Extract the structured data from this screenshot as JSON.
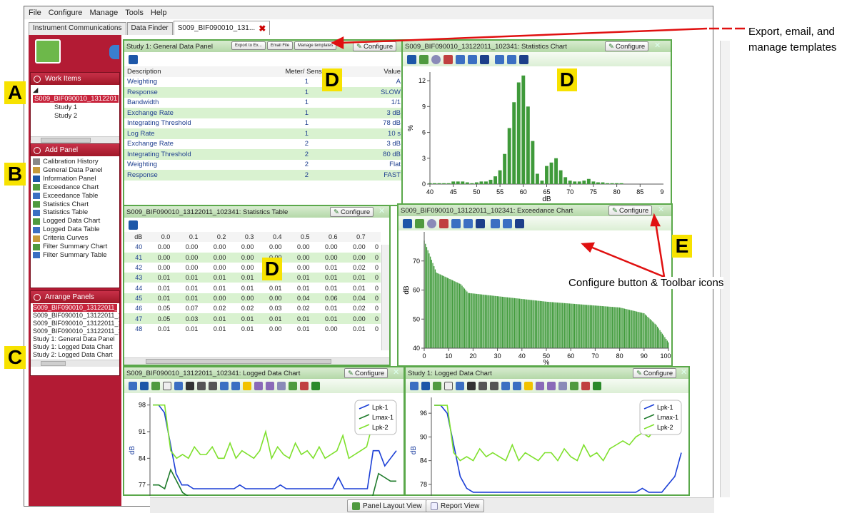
{
  "menu": [
    "File",
    "Configure",
    "Manage",
    "Tools",
    "Help"
  ],
  "tabs": {
    "t1": "Instrument Communications",
    "t2": "Data Finder",
    "t3": "S009_BIF090010_131..."
  },
  "work_items": {
    "title": "Work Items",
    "root": "S009_BIF090010_1312201",
    "children": [
      "Study 1",
      "Study 2"
    ]
  },
  "add_panel": {
    "title": "Add Panel",
    "items": [
      "Calibration History",
      "General Data Panel",
      "Information Panel",
      "Exceedance Chart",
      "Exceedance Table",
      "Statistics Chart",
      "Statistics Table",
      "Logged Data Chart",
      "Logged Data Table",
      "Criteria Curves",
      "Filter Summary Chart",
      "Filter Summary Table"
    ]
  },
  "arrange": {
    "title": "Arrange Panels",
    "items": [
      "S009_BIF090010_13122011_1",
      "S009_BIF090010_13122011_1",
      "S009_BIF090010_13122011_1",
      "S009_BIF090010_13122011_1",
      "Study 1: General Data Panel",
      "Study 1: Logged Data Chart",
      "Study 2: Logged Data Chart"
    ]
  },
  "markers": {
    "A": "A",
    "B": "B",
    "C": "C",
    "D": "D",
    "E": "E"
  },
  "configure": "Configure",
  "gdp": {
    "title": "Study 1: General Data Panel",
    "toolbar": [
      "Export to Ex...",
      "Email File",
      "Manage templates"
    ],
    "headers": [
      "Description",
      "Meter/ Sensor",
      "Value"
    ],
    "rows": [
      [
        "Weighting",
        "1",
        "A"
      ],
      [
        "Response",
        "1",
        "SLOW"
      ],
      [
        "Bandwidth",
        "1",
        "1/1"
      ],
      [
        "Exchange Rate",
        "1",
        "3 dB"
      ],
      [
        "Integrating Threshold",
        "1",
        "78 dB"
      ],
      [
        "Log Rate",
        "1",
        "10 s"
      ],
      [
        "Exchange Rate",
        "2",
        "3 dB"
      ],
      [
        "Integrating Threshold",
        "2",
        "80 dB"
      ],
      [
        "Weighting",
        "2",
        "Flat"
      ],
      [
        "Response",
        "2",
        "FAST"
      ]
    ]
  },
  "stat_chart": {
    "title": "S009_BIF090010_13122011_102341: Statistics Chart"
  },
  "stat_table": {
    "title": "S009_BIF090010_13122011_102341: Statistics Table",
    "headers": [
      "dB",
      "0.0",
      "0.1",
      "0.2",
      "0.3",
      "0.4",
      "0.5",
      "0.6",
      "0.7"
    ],
    "rows": [
      [
        "40",
        "0.00",
        "0.00",
        "0.00",
        "0.00",
        "0.00",
        "0.00",
        "0.00",
        "0.00",
        "0"
      ],
      [
        "41",
        "0.00",
        "0.00",
        "0.00",
        "0.00",
        "0.00",
        "0.00",
        "0.00",
        "0.00",
        "0"
      ],
      [
        "42",
        "0.00",
        "0.00",
        "0.00",
        "0.00",
        "0.00",
        "0.00",
        "0.01",
        "0.02",
        "0"
      ],
      [
        "43",
        "0.01",
        "0.01",
        "0.01",
        "0.01",
        "0.01",
        "0.01",
        "0.01",
        "0.01",
        "0"
      ],
      [
        "44",
        "0.01",
        "0.01",
        "0.01",
        "0.01",
        "0.01",
        "0.01",
        "0.01",
        "0.01",
        "0"
      ],
      [
        "45",
        "0.01",
        "0.01",
        "0.00",
        "0.00",
        "0.00",
        "0.04",
        "0.06",
        "0.04",
        "0"
      ],
      [
        "46",
        "0.05",
        "0.07",
        "0.02",
        "0.02",
        "0.03",
        "0.02",
        "0.01",
        "0.02",
        "0"
      ],
      [
        "47",
        "0.05",
        "0.03",
        "0.01",
        "0.01",
        "0.01",
        "0.01",
        "0.01",
        "0.00",
        "0"
      ],
      [
        "48",
        "0.01",
        "0.01",
        "0.01",
        "0.01",
        "0.00",
        "0.01",
        "0.00",
        "0.01",
        "0"
      ]
    ]
  },
  "exc_chart": {
    "title": "S009_BIF090010_13122011_102341: Exceedance Chart"
  },
  "logged1": {
    "title": "S009_BIF090010_13122011_102341: Logged Data Chart"
  },
  "logged2": {
    "title": "Study 1: Logged Data Chart"
  },
  "bottom": {
    "panel_layout": "Panel Layout View",
    "report": "Report View"
  },
  "annotations": {
    "export": "Export, email, and",
    "export2": "manage templates",
    "configure": "Configure button & Toolbar  icons"
  },
  "colors": {
    "panel_green": "#5aa84a",
    "sidebar_red": "#b31b34",
    "bar_green": "#3f9a3a",
    "lpk1": "#1b3fd6",
    "lmax1": "#1d7a2a",
    "lpk2": "#7ee02c"
  },
  "chart_data": [
    {
      "type": "bar",
      "x": [
        40,
        41,
        42,
        43,
        44,
        45,
        46,
        47,
        48,
        49,
        50,
        51,
        52,
        53,
        54,
        55,
        56,
        57,
        58,
        59,
        60,
        61,
        62,
        63,
        64,
        65,
        66,
        67,
        68,
        69,
        70,
        71,
        72,
        73,
        74,
        75,
        76,
        77,
        78,
        79,
        80,
        81,
        82,
        83,
        84,
        85,
        86,
        87,
        88,
        89,
        90
      ],
      "values": [
        0.1,
        0.1,
        0.1,
        0.1,
        0.1,
        0.3,
        0.3,
        0.3,
        0.2,
        0.1,
        0.2,
        0.3,
        0.3,
        0.5,
        0.9,
        1.6,
        3.5,
        6.5,
        9.5,
        11.8,
        12.6,
        9.0,
        5.0,
        1.2,
        0.4,
        2.1,
        2.5,
        3.0,
        1.6,
        0.8,
        0.4,
        0.3,
        0.3,
        0.4,
        0.6,
        0.3,
        0.2,
        0.2,
        0.1,
        0.1,
        0.1,
        0.1,
        0,
        0,
        0,
        0,
        0,
        0,
        0,
        0,
        0
      ],
      "xlabel": "dB",
      "ylabel": "%",
      "xlim": [
        40,
        90
      ],
      "ylim": [
        0,
        13
      ],
      "xticks": [
        40,
        45,
        50,
        55,
        60,
        65,
        70,
        75,
        80,
        85
      ],
      "yticks": [
        0,
        3,
        6,
        9,
        12
      ]
    },
    {
      "type": "bar",
      "x_range": [
        0,
        100
      ],
      "values_start": 77,
      "values_knee": [
        [
          0,
          77
        ],
        [
          5,
          66
        ],
        [
          15,
          62
        ],
        [
          18,
          59
        ],
        [
          50,
          56
        ],
        [
          80,
          54
        ],
        [
          90,
          52
        ],
        [
          95,
          48
        ],
        [
          100,
          42
        ]
      ],
      "xlabel": "%",
      "ylabel": "dB",
      "xlim": [
        0,
        100
      ],
      "ylim": [
        40,
        80
      ],
      "xticks": [
        0,
        10,
        20,
        30,
        40,
        50,
        60,
        70,
        80,
        90,
        100
      ],
      "yticks": [
        40,
        50,
        60,
        70
      ]
    },
    {
      "type": "line",
      "series": [
        {
          "name": "Lpk-1",
          "values": [
            98,
            98,
            96,
            88,
            80,
            77,
            77,
            76,
            76,
            76,
            76,
            76,
            76,
            76,
            76,
            77,
            76,
            76,
            76,
            76,
            76,
            76,
            77,
            76,
            76,
            76,
            76,
            76,
            76,
            76,
            76,
            76,
            79,
            76,
            76,
            76,
            76,
            76,
            86,
            86,
            82,
            84,
            86
          ]
        },
        {
          "name": "Lmax-1",
          "values": [
            77,
            77,
            76,
            81,
            78,
            75,
            74,
            74,
            74,
            74,
            74,
            74,
            74,
            74,
            74,
            74,
            74,
            74,
            74,
            74,
            74,
            74,
            74,
            74,
            74,
            74,
            74,
            74,
            74,
            74,
            74,
            74,
            74,
            74,
            74,
            74,
            74,
            74,
            80,
            79,
            78,
            78
          ]
        },
        {
          "name": "Lpk-2",
          "values": [
            98,
            98,
            98,
            86,
            84,
            85,
            84,
            87,
            85,
            85,
            87,
            84,
            84,
            88,
            84,
            86,
            85,
            84,
            86,
            91,
            84,
            87,
            85,
            84,
            88,
            85,
            86,
            84,
            87,
            84,
            85,
            86,
            90,
            84,
            85,
            86,
            87,
            93,
            96,
            97,
            95,
            98
          ]
        }
      ],
      "ylabel": "dB",
      "ylim": [
        73,
        100
      ],
      "yticks": [
        77,
        84,
        91,
        98
      ]
    },
    {
      "type": "line",
      "series": [
        {
          "name": "Lpk-1",
          "values": [
            98,
            98,
            96,
            88,
            80,
            77,
            76,
            76,
            76,
            76,
            76,
            76,
            76,
            76,
            76,
            76,
            76,
            76,
            76,
            76,
            76,
            76,
            76,
            76,
            76,
            76,
            76,
            76,
            76,
            76,
            76,
            76,
            77,
            76,
            76,
            76,
            78,
            80,
            86
          ]
        },
        {
          "name": "Lmax-1",
          "values": []
        },
        {
          "name": "Lpk-2",
          "values": [
            98,
            98,
            98,
            86,
            84,
            85,
            84,
            87,
            85,
            86,
            85,
            84,
            88,
            84,
            86,
            85,
            84,
            86,
            86,
            84,
            87,
            85,
            84,
            88,
            85,
            86,
            84,
            87,
            88,
            89,
            88,
            90,
            91,
            90,
            92,
            96,
            97,
            95,
            98
          ]
        }
      ],
      "ylabel": "dB",
      "ylim": [
        74,
        100
      ],
      "yticks": [
        78,
        84,
        90,
        96
      ]
    }
  ]
}
